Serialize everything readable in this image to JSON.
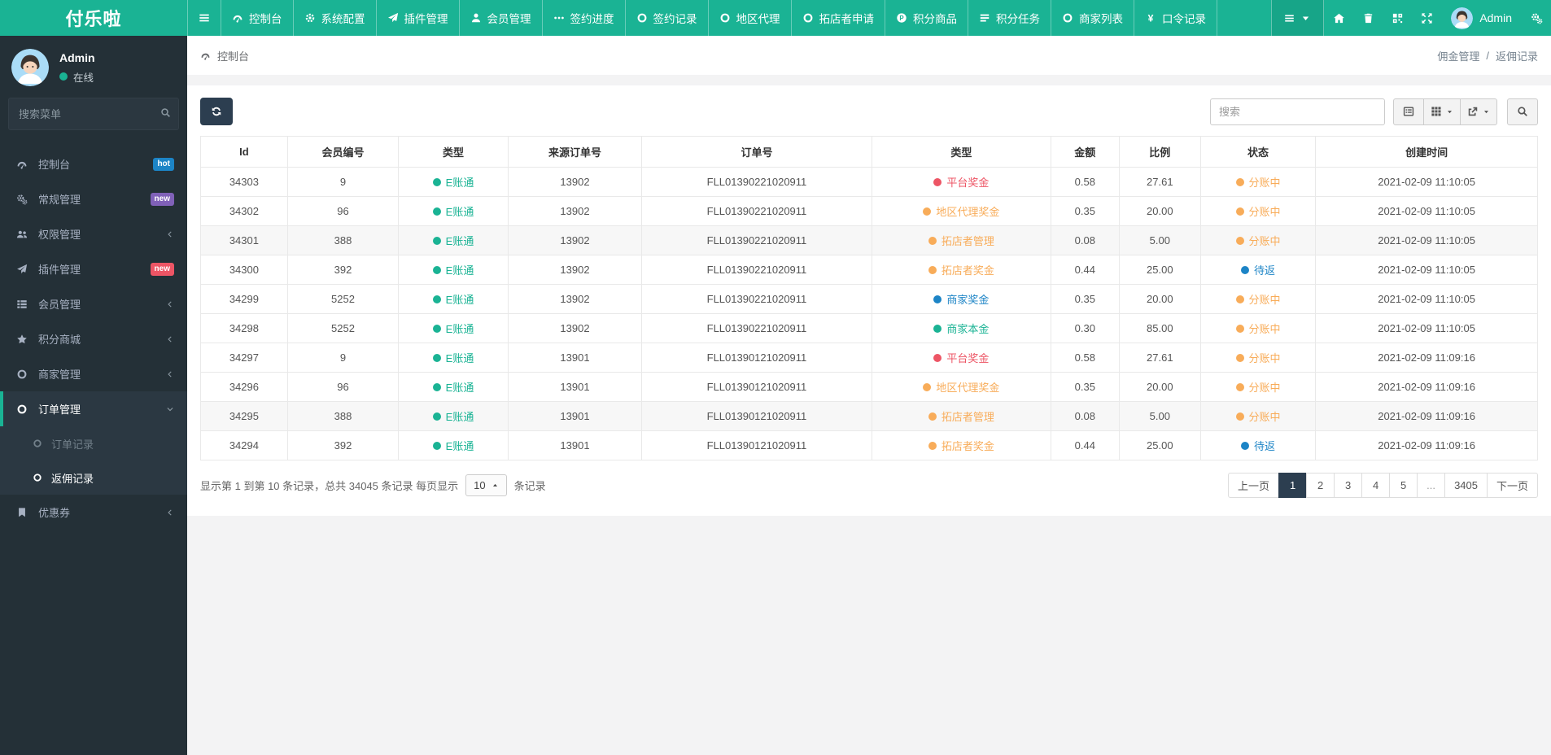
{
  "colors": {
    "primary_green": "#1ab394",
    "orange": "#f8ac59",
    "red": "#ed5565",
    "blue": "#1c84c6",
    "navy": "#2c3e50",
    "sidebar_bg": "#243037",
    "badge_hot": "#1c84c6",
    "badge_new_purple": "#8061b8",
    "badge_new_red": "#ed5565"
  },
  "brand": "付乐啦",
  "topnav": {
    "items": [
      {
        "label": "控制台",
        "icon": "gauge"
      },
      {
        "label": "系统配置",
        "icon": "gear"
      },
      {
        "label": "插件管理",
        "icon": "plane"
      },
      {
        "label": "会员管理",
        "icon": "user"
      },
      {
        "label": "签约进度",
        "icon": "ellipsis"
      },
      {
        "label": "签约记录",
        "icon": "circle"
      },
      {
        "label": "地区代理",
        "icon": "circle"
      },
      {
        "label": "拓店者申请",
        "icon": "circle"
      },
      {
        "label": "积分商品",
        "icon": "p-circle"
      },
      {
        "label": "积分任务",
        "icon": "tasks"
      },
      {
        "label": "商家列表",
        "icon": "circle"
      },
      {
        "label": "口令记录",
        "icon": "yen"
      }
    ],
    "user_name": "Admin"
  },
  "sidebar": {
    "user_name": "Admin",
    "status": "在线",
    "search_placeholder": "搜索菜单",
    "items": [
      {
        "label": "控制台",
        "icon": "gauge",
        "badge": "hot",
        "badge_color": "#1c84c6"
      },
      {
        "label": "常规管理",
        "icon": "cogs",
        "badge": "new",
        "badge_color": "#8061b8"
      },
      {
        "label": "权限管理",
        "icon": "users",
        "chevron": "left"
      },
      {
        "label": "插件管理",
        "icon": "plane",
        "badge": "new",
        "badge_color": "#ed5565"
      },
      {
        "label": "会员管理",
        "icon": "th-list",
        "chevron": "left"
      },
      {
        "label": "积分商城",
        "icon": "star",
        "chevron": "left"
      },
      {
        "label": "商家管理",
        "icon": "circle",
        "chevron": "left"
      },
      {
        "label": "订单管理",
        "icon": "circle",
        "chevron": "down",
        "state": "parent-active"
      },
      {
        "label": "订单记录",
        "icon": "circle",
        "state": "sub"
      },
      {
        "label": "返佣记录",
        "icon": "circle",
        "state": "sub-active"
      },
      {
        "label": "优惠券",
        "icon": "bookmark",
        "chevron": "left"
      }
    ]
  },
  "breadcrumb": {
    "left": "控制台",
    "right": [
      "佣金管理",
      "返佣记录"
    ],
    "separator": "/"
  },
  "toolbar": {
    "search_placeholder": "搜索"
  },
  "table": {
    "headers": [
      "Id",
      "会员编号",
      "类型",
      "来源订单号",
      "订单号",
      "类型",
      "金额",
      "比例",
      "状态",
      "创建时间"
    ],
    "account_type_color": "#1ab394",
    "rows": [
      {
        "id": "34303",
        "member": "9",
        "account_type": "E账通",
        "source": "13902",
        "order": "FLL01390221020911",
        "bonus": "平台奖金",
        "bonus_color": "#ed5565",
        "amount": "0.58",
        "ratio": "27.61",
        "status": "分账中",
        "status_color": "#f8ac59",
        "created": "2021-02-09 11:10:05"
      },
      {
        "id": "34302",
        "member": "96",
        "account_type": "E账通",
        "source": "13902",
        "order": "FLL01390221020911",
        "bonus": "地区代理奖金",
        "bonus_color": "#f8ac59",
        "amount": "0.35",
        "ratio": "20.00",
        "status": "分账中",
        "status_color": "#f8ac59",
        "created": "2021-02-09 11:10:05"
      },
      {
        "id": "34301",
        "member": "388",
        "account_type": "E账通",
        "source": "13902",
        "order": "FLL01390221020911",
        "bonus": "拓店者管理",
        "bonus_color": "#f8ac59",
        "amount": "0.08",
        "ratio": "5.00",
        "status": "分账中",
        "status_color": "#f8ac59",
        "created": "2021-02-09 11:10:05"
      },
      {
        "id": "34300",
        "member": "392",
        "account_type": "E账通",
        "source": "13902",
        "order": "FLL01390221020911",
        "bonus": "拓店者奖金",
        "bonus_color": "#f8ac59",
        "amount": "0.44",
        "ratio": "25.00",
        "status": "待返",
        "status_color": "#1c84c6",
        "created": "2021-02-09 11:10:05"
      },
      {
        "id": "34299",
        "member": "5252",
        "account_type": "E账通",
        "source": "13902",
        "order": "FLL01390221020911",
        "bonus": "商家奖金",
        "bonus_color": "#1c84c6",
        "amount": "0.35",
        "ratio": "20.00",
        "status": "分账中",
        "status_color": "#f8ac59",
        "created": "2021-02-09 11:10:05"
      },
      {
        "id": "34298",
        "member": "5252",
        "account_type": "E账通",
        "source": "13902",
        "order": "FLL01390221020911",
        "bonus": "商家本金",
        "bonus_color": "#1ab394",
        "amount": "0.30",
        "ratio": "85.00",
        "status": "分账中",
        "status_color": "#f8ac59",
        "created": "2021-02-09 11:10:05"
      },
      {
        "id": "34297",
        "member": "9",
        "account_type": "E账通",
        "source": "13901",
        "order": "FLL01390121020911",
        "bonus": "平台奖金",
        "bonus_color": "#ed5565",
        "amount": "0.58",
        "ratio": "27.61",
        "status": "分账中",
        "status_color": "#f8ac59",
        "created": "2021-02-09 11:09:16"
      },
      {
        "id": "34296",
        "member": "96",
        "account_type": "E账通",
        "source": "13901",
        "order": "FLL01390121020911",
        "bonus": "地区代理奖金",
        "bonus_color": "#f8ac59",
        "amount": "0.35",
        "ratio": "20.00",
        "status": "分账中",
        "status_color": "#f8ac59",
        "created": "2021-02-09 11:09:16"
      },
      {
        "id": "34295",
        "member": "388",
        "account_type": "E账通",
        "source": "13901",
        "order": "FLL01390121020911",
        "bonus": "拓店者管理",
        "bonus_color": "#f8ac59",
        "amount": "0.08",
        "ratio": "5.00",
        "status": "分账中",
        "status_color": "#f8ac59",
        "created": "2021-02-09 11:09:16"
      },
      {
        "id": "34294",
        "member": "392",
        "account_type": "E账通",
        "source": "13901",
        "order": "FLL01390121020911",
        "bonus": "拓店者奖金",
        "bonus_color": "#f8ac59",
        "amount": "0.44",
        "ratio": "25.00",
        "status": "待返",
        "status_color": "#1c84c6",
        "created": "2021-02-09 11:09:16"
      }
    ]
  },
  "pagination": {
    "summary_prefix": "显示第 1 到第 10 条记录，总共 34045 条记录 每页显示",
    "page_size": "10",
    "summary_suffix": "条记录",
    "pages": [
      "上一页",
      "1",
      "2",
      "3",
      "4",
      "5",
      "...",
      "3405",
      "下一页"
    ],
    "active_page": "1"
  }
}
